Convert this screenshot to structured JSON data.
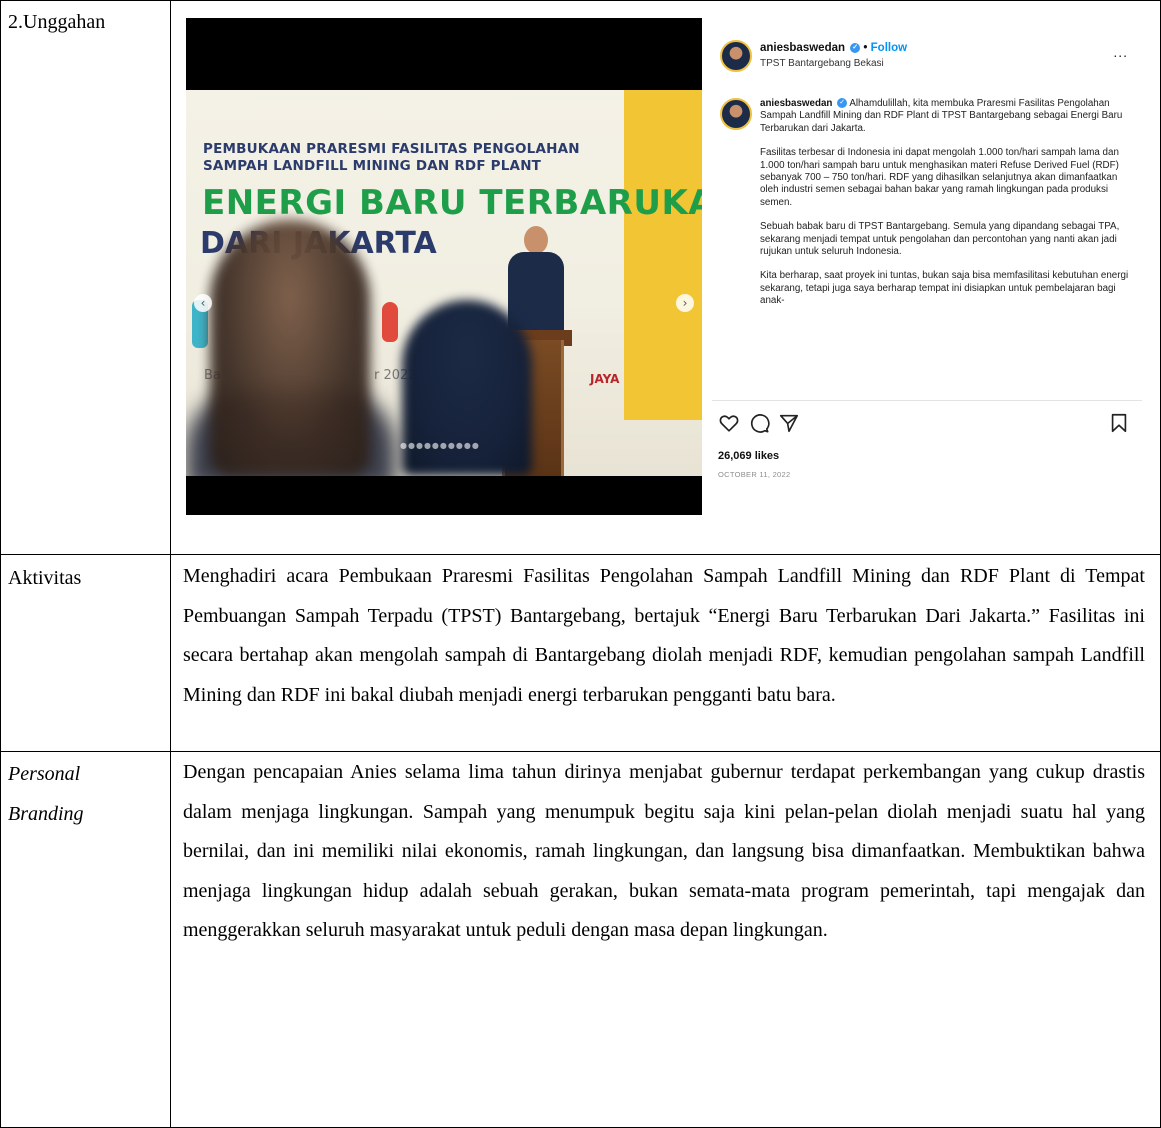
{
  "rows": {
    "unggahan_label": "2.Unggahan",
    "aktivitas_label": "Aktivitas",
    "personal_label_1": "Personal",
    "personal_label_2": "Branding",
    "aktivitas_text": "Menghadiri acara Pembukaan Praresmi Fasilitas Pengolahan Sampah Landfill Mining dan RDF Plant di Tempat Pembuangan Sampah Terpadu (TPST) Bantargebang, bertajuk “Energi Baru Terbarukan Dari Jakarta.” Fasilitas ini secara bertahap akan mengolah sampah di Bantargebang diolah menjadi RDF, kemudian pengolahan sampah Landfill Mining dan RDF ini bakal diubah menjadi energi terbarukan pengganti batu bara.",
    "personal_text": "Dengan pencapaian Anies selama lima tahun dirinya menjabat gubernur terdapat perkembangan yang cukup drastis dalam menjaga lingkungan. Sampah yang menumpuk begitu saja kini pelan-pelan diolah menjadi suatu hal yang bernilai, dan ini memiliki nilai ekonomis, ramah lingkungan, dan langsung bisa dimanfaatkan. Membuktikan bahwa menjaga lingkungan hidup adalah sebuah gerakan, bukan semata-mata program pemerintah, tapi mengajak dan menggerakkan seluruh masyarakat untuk peduli dengan masa depan lingkungan."
  },
  "photo": {
    "banner_subtitle": "PEMBUKAAN PRARESMI FASILITAS PENGOLAHAN SAMPAH LANDFILL MINING DAN RDF PLANT",
    "banner_title": "ENERGI BARU TERBARUKAN",
    "banner_title2": "DARI JAKARTA",
    "year_left": "Ba",
    "year_right": "r 2022",
    "sponsor": "JAYA",
    "prev_arrow": "‹",
    "next_arrow": "›",
    "carousel_dots": "●●●●●●●●●●"
  },
  "instagram": {
    "username": "aniesbaswedan",
    "follow_label": "Follow",
    "separator": "•",
    "location": "TPST Bantargebang Bekasi",
    "more_label": "...",
    "caption_p1": "Alhamdulillah, kita membuka Praresmi Fasilitas Pengolahan Sampah Landfill Mining dan RDF Plant di TPST Bantargebang sebagai Energi Baru Terbarukan dari Jakarta.",
    "caption_p2": "Fasilitas terbesar di Indonesia ini dapat mengolah 1.000 ton/hari sampah lama dan 1.000 ton/hari sampah baru untuk menghasikan materi Refuse Derived Fuel (RDF) sebanyak 700 – 750 ton/hari. RDF yang dihasilkan selanjutnya akan dimanfaatkan oleh industri semen sebagai bahan bakar yang ramah lingkungan pada produksi semen.",
    "caption_p3": "Sebuah babak baru di TPST Bantargebang. Semula yang dipandang sebagai TPA, sekarang menjadi tempat untuk pengolahan dan percontohan yang nanti akan jadi rujukan untuk seluruh Indonesia.",
    "caption_p4": "Kita berharap, saat proyek ini tuntas, bukan saja bisa memfasilitasi kebutuhan energi sekarang, tetapi juga saya berharap tempat ini disiapkan untuk pembelajaran bagi anak-",
    "likes": "26,069 likes",
    "date": "OCTOBER 11, 2022",
    "icons": [
      "heart-icon",
      "comment-icon",
      "share-icon",
      "bookmark-icon"
    ]
  }
}
